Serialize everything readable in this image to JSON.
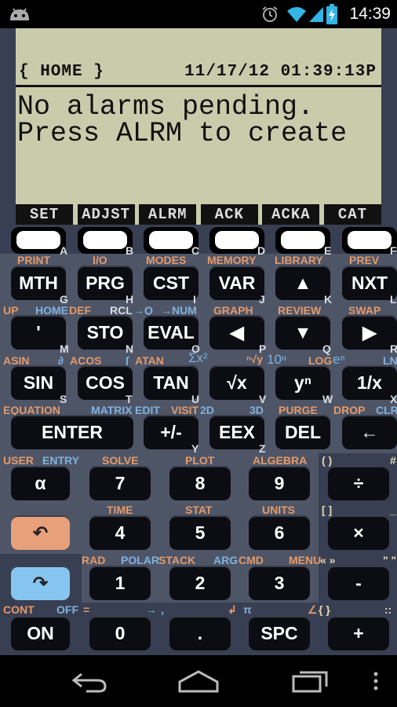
{
  "status_bar": {
    "time": "14:39",
    "icons": [
      "android-icon",
      "alarm-clock-icon",
      "wifi-icon",
      "signal-icon",
      "battery-charging-icon"
    ]
  },
  "lcd": {
    "home": "{ HOME }",
    "datetime": "11/17/12 01:39:13P",
    "message_line1": "No alarms pending.",
    "message_line2": "Press ALRM to create",
    "softkeys": [
      "SET",
      "ADJST",
      "ALRM",
      "ACK",
      "ACKA",
      "CAT"
    ]
  },
  "fkey_letters": [
    "A",
    "B",
    "C",
    "D",
    "E",
    "F"
  ],
  "rows": {
    "r1": {
      "shift_labels": [
        "PRINT",
        "I/O",
        "MODES",
        "MEMORY",
        "LIBRARY",
        "PREV"
      ],
      "keys": [
        "MTH",
        "PRG",
        "CST",
        "VAR",
        "▲",
        "NXT"
      ],
      "letters": [
        "G",
        "H",
        "I",
        "J",
        "K",
        "L"
      ]
    },
    "r2": {
      "shift_labels": [
        "UP",
        "HOME",
        "DEF",
        "RCL",
        "→Q",
        "→NUM",
        "GRAPH",
        "REVIEW",
        "SWAP"
      ],
      "keys": [
        "'",
        "STO",
        "EVAL",
        "◀",
        "▼",
        "▶"
      ],
      "letters": [
        "M",
        "N",
        "O",
        "P",
        "Q",
        "R"
      ]
    },
    "r3": {
      "shift_labels": [
        "ASIN",
        "∂",
        "ACOS",
        "∫",
        "ATAN",
        "Σx²",
        "ⁿ√y",
        "10ⁿ",
        "LOG",
        "eⁿ",
        "LN"
      ],
      "keys": [
        "SIN",
        "COS",
        "TAN",
        "√x",
        "yⁿ",
        "1/x"
      ],
      "letters": [
        "S",
        "T",
        "U",
        "V",
        "W",
        "X"
      ]
    },
    "r4": {
      "shift_labels": [
        "EQUATION",
        "MATRIX",
        "EDIT",
        "VISIT",
        "2D",
        "3D",
        "PURGE",
        "DROP",
        "CLR"
      ],
      "keys": [
        "ENTER",
        "+/-",
        "EEX",
        "DEL",
        "←"
      ],
      "letters": [
        "Y",
        "Z"
      ]
    },
    "r5": {
      "shift_labels": [
        "USER",
        "ENTRY",
        "SOLVE",
        "PLOT",
        "ALGEBRA",
        "( )",
        "#"
      ],
      "keys": [
        "α",
        "7",
        "8",
        "9",
        "÷"
      ]
    },
    "r6": {
      "shift_labels": [
        "TIME",
        "STAT",
        "UNITS",
        "[ ]",
        "_"
      ],
      "keys": [
        "↶",
        "4",
        "5",
        "6",
        "×"
      ]
    },
    "r7": {
      "shift_labels": [
        "RAD",
        "POLAR",
        "STACK",
        "ARG",
        "CMD",
        "MENU",
        "« »",
        "\" \""
      ],
      "keys": [
        "↷",
        "1",
        "2",
        "3",
        "-"
      ]
    },
    "r8": {
      "shift_labels": [
        "CONT",
        "OFF",
        "=",
        "→",
        ",",
        "↲",
        "π",
        "∠",
        "{ }",
        "::"
      ],
      "keys": [
        "ON",
        "0",
        ".",
        "SPC",
        "+"
      ]
    }
  },
  "colors": {
    "body": "#393f52",
    "panel": "#4e5567",
    "lcd": "#c9ccab",
    "left_shift": "#e49a6a",
    "right_shift": "#7fb2de",
    "key": "#0b0d12"
  }
}
